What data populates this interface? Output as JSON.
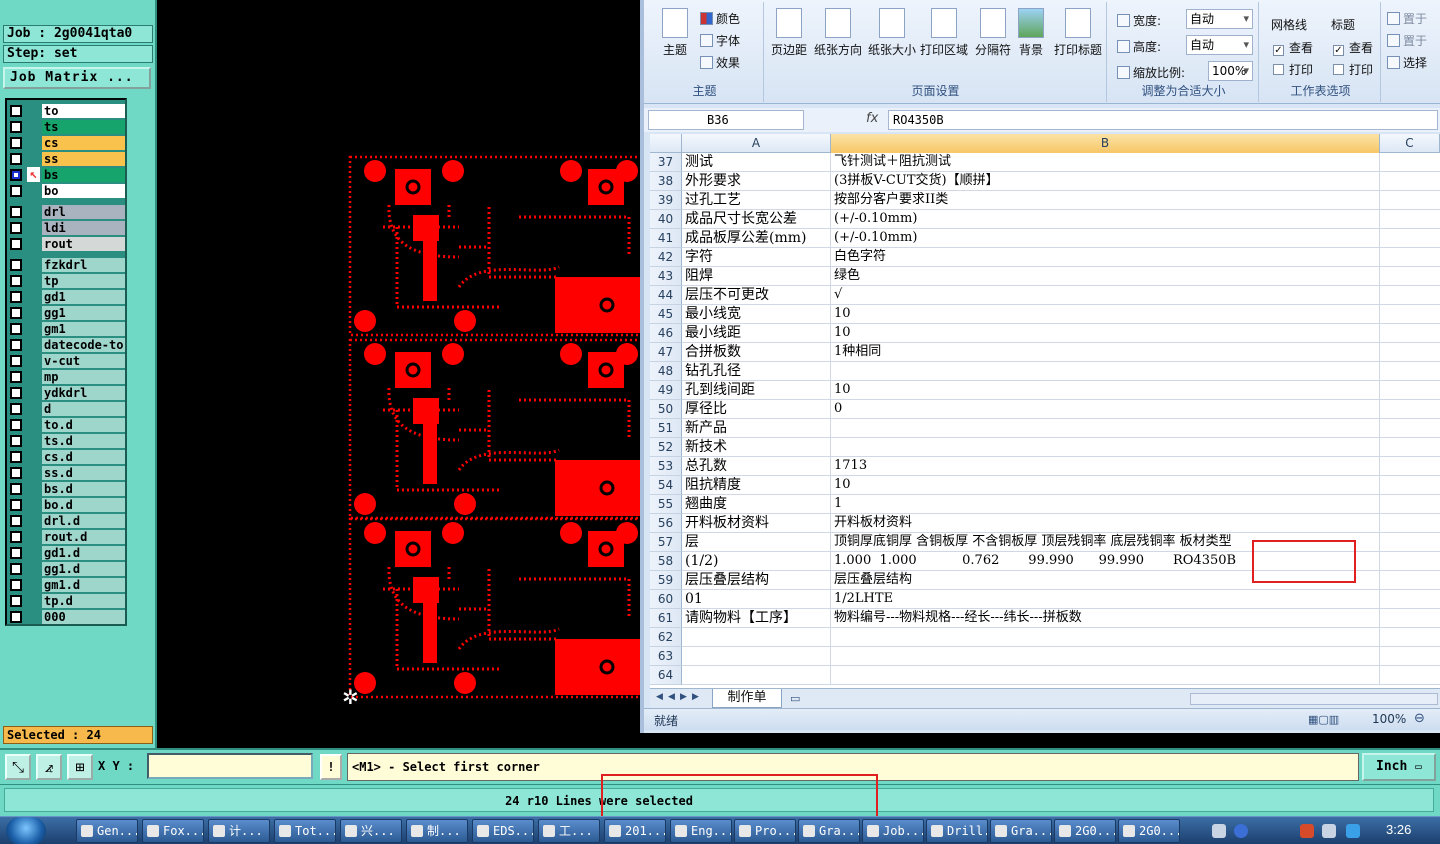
{
  "genesis": {
    "job_label": "Job : 2g0041qta0",
    "step_label": "Step: set",
    "job_matrix_button": "Job Matrix ...",
    "selected_label": "Selected : 24",
    "layers_board": [
      "to",
      "ts",
      "cs",
      "ss",
      "bs",
      "bo"
    ],
    "layers_drill": [
      "drl",
      "ldi",
      "rout"
    ],
    "layers_misc": [
      "fzkdrl",
      "tp",
      "gd1",
      "gg1",
      "gm1",
      "datecode-to",
      "v-cut",
      "mp",
      "ydkdrl",
      "d",
      "to.d",
      "ts.d",
      "cs.d",
      "ss.d",
      "bs.d",
      "bo.d",
      "drl.d",
      "rout.d",
      "gd1.d",
      "gg1.d",
      "gm1.d",
      "tp.d",
      "000"
    ],
    "active_layer": "bs",
    "xy_label": "X Y :",
    "xy_value": "",
    "prompt": "<M1> - Select first corner",
    "units": "Inch",
    "message": "24 r10 Lines were selected",
    "colors": {
      "panel": "#6fd9c6",
      "pcb_red": "#ff0000",
      "canvas": "#000000"
    }
  },
  "excel": {
    "ribbon": {
      "theme_group": {
        "theme": "主题",
        "colors": "颜色",
        "fonts": "字体",
        "effects": "效果",
        "label": "主题"
      },
      "page_setup": {
        "margins": "页边距",
        "orientation": "纸张方向",
        "size": "纸张大小",
        "print_area": "打印区域",
        "breaks": "分隔符",
        "background": "背景",
        "print_titles": "打印标题",
        "label": "页面设置"
      },
      "scale": {
        "width": "宽度:",
        "width_val": "自动",
        "height": "高度:",
        "height_val": "自动",
        "scale": "缩放比例:",
        "scale_val": "100%",
        "label": "调整为合适大小"
      },
      "sheet_options": {
        "gridlines": "网格线",
        "headings": "标题",
        "view": "查看",
        "print": "打印",
        "label": "工作表选项"
      },
      "arrange": {
        "bring_front": "置于",
        "send_back": "置于",
        "selection": "选择"
      }
    },
    "name_box": "B36",
    "fx": "fx",
    "formula": "RO4350B",
    "columns": [
      "A",
      "B",
      "C"
    ],
    "rows": [
      {
        "n": "37",
        "a": "测试",
        "b": "飞针测试＋阻抗测试"
      },
      {
        "n": "38",
        "a": "外形要求",
        "b": "(3拼板V-CUT交货)【顺拼】"
      },
      {
        "n": "39",
        "a": "过孔工艺",
        "b": "按部分客户要求II类"
      },
      {
        "n": "40",
        "a": "成品尺寸长宽公差",
        "b": "(+/-0.10mm)"
      },
      {
        "n": "41",
        "a": "成品板厚公差(mm)",
        "b": "(+/-0.10mm)"
      },
      {
        "n": "42",
        "a": "字符",
        "b": "白色字符"
      },
      {
        "n": "43",
        "a": "阻焊",
        "b": "绿色"
      },
      {
        "n": "44",
        "a": "层压不可更改",
        "b": "√"
      },
      {
        "n": "45",
        "a": "最小线宽",
        "b": "10"
      },
      {
        "n": "46",
        "a": "最小线距",
        "b": "10"
      },
      {
        "n": "47",
        "a": "合拼板数",
        "b": "1种相同"
      },
      {
        "n": "48",
        "a": "钻孔孔径",
        "b": ""
      },
      {
        "n": "49",
        "a": "孔到线间距",
        "b": "10"
      },
      {
        "n": "50",
        "a": "厚径比",
        "b": "0"
      },
      {
        "n": "51",
        "a": "新产品",
        "b": ""
      },
      {
        "n": "52",
        "a": "新技术",
        "b": ""
      },
      {
        "n": "53",
        "a": "总孔数",
        "b": "1713"
      },
      {
        "n": "54",
        "a": "阻抗精度",
        "b": "10"
      },
      {
        "n": "55",
        "a": "翘曲度",
        "b": "1"
      },
      {
        "n": "56",
        "a": "开料板材资料",
        "b": "开料板材资料"
      },
      {
        "n": "57",
        "a": "层",
        "b": "顶铜厚底铜厚 含铜板厚 不含铜板厚 顶层残铜率 底层残铜率 板材类型"
      },
      {
        "n": "58",
        "a": "(1/2)",
        "b": "1.000  1.000           0.762       99.990      99.990       RO4350B"
      },
      {
        "n": "59",
        "a": "层压叠层结构",
        "b": "层压叠层结构"
      },
      {
        "n": "60",
        "a": "01",
        "b": "1/2LHTE"
      },
      {
        "n": "61",
        "a": "请购物料【工序】",
        "b": "物料编号---物料规格---经长---纬长---拼板数"
      },
      {
        "n": "62",
        "a": "",
        "b": ""
      },
      {
        "n": "63",
        "a": "",
        "b": ""
      },
      {
        "n": "64",
        "a": "",
        "b": ""
      }
    ],
    "sheet_tab": "制作单",
    "status": "就绪",
    "zoom": "100%"
  },
  "taskbar": {
    "items": [
      "Gen...",
      "Fox...",
      "计...",
      "Tot...",
      "兴...",
      "制...",
      "EDS...",
      "工...",
      "201...",
      "Eng...",
      "Pro...",
      "Gra...",
      "Job...",
      "Drill...",
      "Gra...",
      "2G0...",
      "2G0..."
    ],
    "clock": "3:26"
  }
}
